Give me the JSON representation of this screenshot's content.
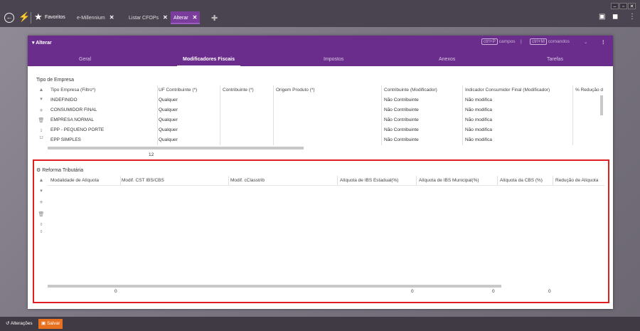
{
  "topbar": {
    "favorites_label": "Favoritos",
    "tabs": [
      {
        "label": "e-Millennium",
        "close": "✕"
      },
      {
        "label": "Listar CFOPs",
        "close": "✕"
      },
      {
        "label": "Alterar",
        "close": "✕"
      }
    ],
    "window_buttons": [
      "–",
      "▫",
      "✕"
    ]
  },
  "panel": {
    "title": "Alterar",
    "shortcut_campos_key": "ctrl+P",
    "shortcut_campos": "campos",
    "shortcut_sep": "|",
    "shortcut_comandos_key": "ctrl+M",
    "shortcut_comandos": "comandos",
    "tabs": [
      {
        "label": "Geral"
      },
      {
        "label": "Modificadores Fiscais"
      },
      {
        "label": "Impostos"
      },
      {
        "label": "Anexos"
      },
      {
        "label": "Tarefas"
      }
    ]
  },
  "tipo_empresa": {
    "section_label": "Tipo de Empresa",
    "columns": [
      "Tipo Empresa (Filtro*)",
      "UF Contribuinte (*)",
      "Contribuinte (*)",
      "Origem Produto (*)",
      "Contribuinte (Modificador)",
      "Indicador Consumidor Final (Modificador)",
      "% Redução d"
    ],
    "rows": [
      [
        "INDEFINIDO",
        "Qualquer",
        "",
        "",
        "Não Contribuinte",
        "Não modifica"
      ],
      [
        "CONSUMIDOR FINAL",
        "Qualquer",
        "",
        "",
        "Não Contribuinte",
        "Não modifica"
      ],
      [
        "EMPRESA NORMAL",
        "Qualquer",
        "",
        "",
        "Não Contribuinte",
        "Não modifica"
      ],
      [
        "EPP - PEQUENO PORTE",
        "Qualquer",
        "",
        "",
        "Não Contribuinte",
        "Não modifica"
      ],
      [
        "EPP SIMPLES",
        "Qualquer",
        "",
        "",
        "Não Contribuinte",
        "Não modifica"
      ]
    ],
    "side_numbers": [
      "1",
      "12"
    ],
    "footer_count": "12"
  },
  "reforma": {
    "section_label": "Reforma Tributária",
    "columns": [
      "Modalidade de Alíquota",
      "Modif. CST IBS/CBS",
      "Modif. cClasstrib",
      "Alíquota de IBS Estadual(%)",
      "Alíquota de IBS Municipal(%)",
      "Alíquota da CBS (%)",
      "Redução de Alíquota"
    ],
    "side_numbers": [
      "0",
      "0"
    ],
    "footer": [
      "0",
      "0",
      "0",
      "0"
    ]
  },
  "bottombar": {
    "alteracoes": "Alterações",
    "salvar": "Salvar"
  },
  "colors": {
    "accent": "#6a2d8c",
    "highlight": "#e02020",
    "save": "#e8711f"
  }
}
